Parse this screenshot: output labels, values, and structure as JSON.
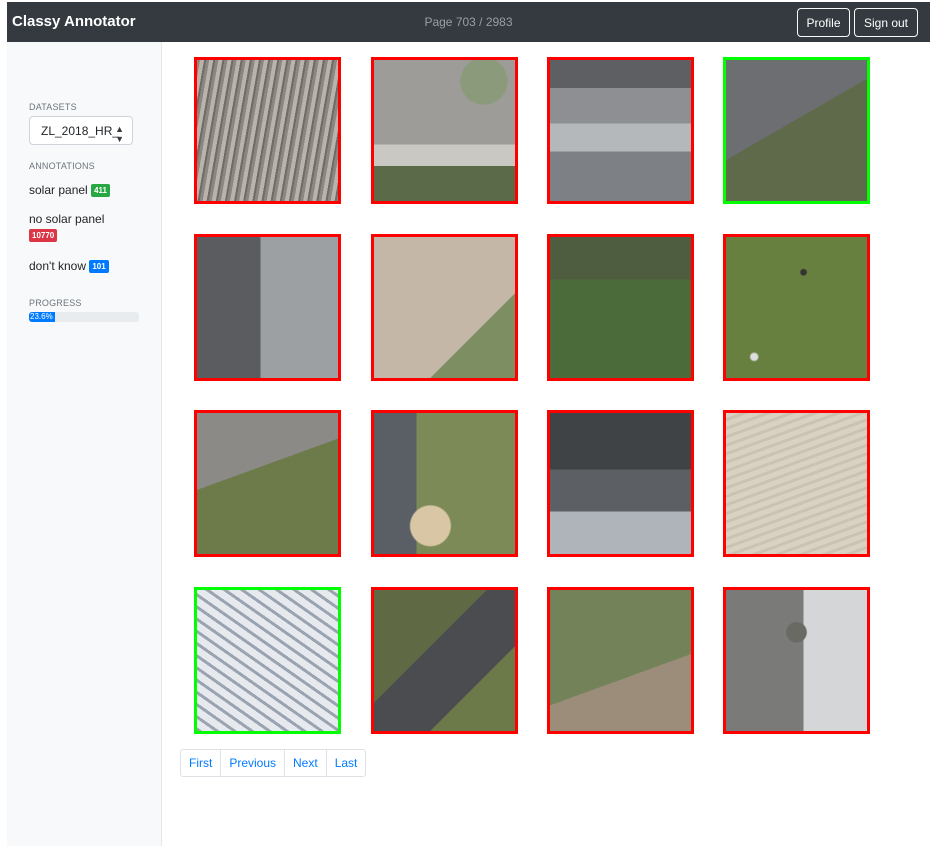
{
  "app": {
    "title": "Classy Annotator",
    "page_indicator": "Page 703 / 2983"
  },
  "header": {
    "profile_label": "Profile",
    "signout_label": "Sign out"
  },
  "sidebar": {
    "datasets_title": "DATASETS",
    "dataset_selected": "ZL_2018_HR_",
    "annotations_title": "ANNOTATIONS",
    "annotations": [
      {
        "label": "solar panel",
        "count": "411",
        "color": "#28a745"
      },
      {
        "label": "no solar panel",
        "count": "10770",
        "color": "#dc3545"
      },
      {
        "label": "don't know",
        "count": "101",
        "color": "#007bff"
      }
    ],
    "progress_title": "PROGRESS",
    "progress_label": "23.6%",
    "progress_value": 0.236
  },
  "tiles": [
    {
      "status": "no solar panel",
      "scene": "trees"
    },
    {
      "status": "no solar panel",
      "scene": "road-curve"
    },
    {
      "status": "no solar panel",
      "scene": "flat-roof"
    },
    {
      "status": "solar panel",
      "scene": "roof-with-panels"
    },
    {
      "status": "no solar panel",
      "scene": "roof-corner"
    },
    {
      "status": "no solar panel",
      "scene": "sand-field"
    },
    {
      "status": "no solar panel",
      "scene": "garden"
    },
    {
      "status": "no solar panel",
      "scene": "pasture-cows"
    },
    {
      "status": "no solar panel",
      "scene": "sports-field"
    },
    {
      "status": "no solar panel",
      "scene": "shed-dirt"
    },
    {
      "status": "no solar panel",
      "scene": "dense-roofs"
    },
    {
      "status": "no solar panel",
      "scene": "plowed-field"
    },
    {
      "status": "solar panel",
      "scene": "solar-roof"
    },
    {
      "status": "no solar panel",
      "scene": "houses-trees"
    },
    {
      "status": "no solar panel",
      "scene": "yard-car"
    },
    {
      "status": "no solar panel",
      "scene": "street-roundabout"
    }
  ],
  "pagination": {
    "first": "First",
    "previous": "Previous",
    "next": "Next",
    "last": "Last"
  },
  "colors": {
    "positive_border": "#00ff00",
    "negative_border": "#ff0000"
  }
}
